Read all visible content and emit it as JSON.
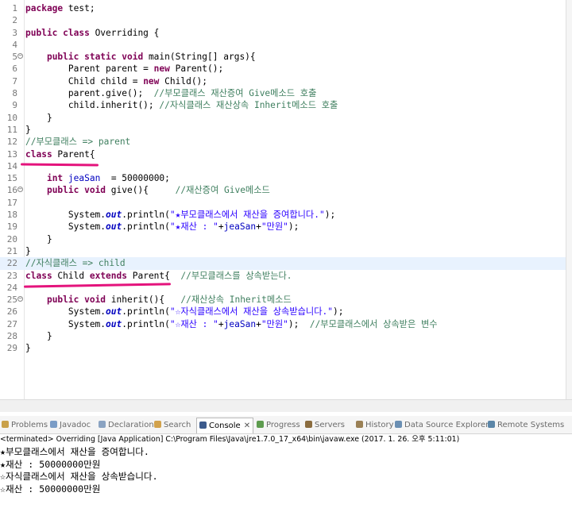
{
  "editor": {
    "lines": [
      {
        "n": "1",
        "fold": "",
        "html": "<span class='k'>package</span> test;"
      },
      {
        "n": "2",
        "fold": "",
        "html": ""
      },
      {
        "n": "3",
        "fold": "",
        "html": "<span class='k'>public class</span> Overriding {"
      },
      {
        "n": "4",
        "fold": "",
        "html": ""
      },
      {
        "n": "5",
        "fold": "−",
        "html": "    <span class='k'>public static void</span> main(String[] args){"
      },
      {
        "n": "6",
        "fold": "",
        "html": "        Parent parent = <span class='k'>new</span> Parent();"
      },
      {
        "n": "7",
        "fold": "",
        "html": "        Child child = <span class='k'>new</span> Child();"
      },
      {
        "n": "8",
        "fold": "",
        "html": "        parent.give();  <span class='c'>//부모클래스 재산증여 Give메소드 호출</span>"
      },
      {
        "n": "9",
        "fold": "",
        "html": "        child.inherit(); <span class='c'>//자식클래스 재산상속 Inherit메소드 호출</span>"
      },
      {
        "n": "10",
        "fold": "",
        "html": "    }"
      },
      {
        "n": "11",
        "fold": "",
        "html": "}"
      },
      {
        "n": "12",
        "fold": "",
        "html": "<span class='c'>//부모클래스 => parent</span>"
      },
      {
        "n": "13",
        "fold": "",
        "html": "<span class='k'>class</span> Parent{"
      },
      {
        "n": "14",
        "fold": "",
        "html": ""
      },
      {
        "n": "15",
        "fold": "",
        "html": "    <span class='k'>int</span> <span class='fn'>jeaSan</span>  = 50000000;"
      },
      {
        "n": "16",
        "fold": "−",
        "html": "    <span class='k'>public void</span> give(){     <span class='c'>//재산증여 Give메소드</span>"
      },
      {
        "n": "17",
        "fold": "",
        "html": ""
      },
      {
        "n": "18",
        "fold": "",
        "html": "        System.<span class='f'>out</span>.println(<span class='s'>\"★부모클래스에서 재산을 증여합니다.\"</span>);"
      },
      {
        "n": "19",
        "fold": "",
        "html": "        System.<span class='f'>out</span>.println(<span class='s'>\"★재산 : \"</span>+<span class='fn'>jeaSan</span>+<span class='s'>\"만원\"</span>);"
      },
      {
        "n": "20",
        "fold": "",
        "html": "    }"
      },
      {
        "n": "21",
        "fold": "",
        "html": "}"
      },
      {
        "n": "22",
        "fold": "",
        "html": "<span class='c'>//자식클래스 => child</span>",
        "current": true
      },
      {
        "n": "23",
        "fold": "",
        "html": "<span class='k'>class</span> Child <span class='k'>extends</span> Parent{  <span class='c'>//부모클래스를 상속받는다.</span>"
      },
      {
        "n": "24",
        "fold": "",
        "html": ""
      },
      {
        "n": "25",
        "fold": "−",
        "html": "    <span class='k'>public void</span> inherit(){   <span class='c'>//재산상속 Inherit메소드</span>"
      },
      {
        "n": "26",
        "fold": "",
        "html": "        System.<span class='f'>out</span>.println(<span class='s'>\"☆자식클래스에서 재산을 상속받습니다.\"</span>);"
      },
      {
        "n": "27",
        "fold": "",
        "html": "        System.<span class='f'>out</span>.println(<span class='s'>\"☆재산 : \"</span>+<span class='fn'>jeaSan</span>+<span class='s'>\"만원\"</span>);  <span class='c'>//부모클래스에서 상속받은 변수</span>"
      },
      {
        "n": "28",
        "fold": "",
        "html": "    }"
      },
      {
        "n": "29",
        "fold": "",
        "html": "}"
      }
    ]
  },
  "tabs": [
    {
      "label": "Problems",
      "icon": "problems-icon",
      "color": "#c9a14a"
    },
    {
      "label": "Javadoc",
      "icon": "javadoc-icon",
      "color": "#7a9cc6"
    },
    {
      "label": "Declaration",
      "icon": "declaration-icon",
      "color": "#8aa3c2"
    },
    {
      "label": "Search",
      "icon": "search-icon",
      "color": "#d2a24c"
    },
    {
      "label": "Console",
      "icon": "console-icon",
      "color": "#3b5a8c",
      "active": true
    },
    {
      "label": "Progress",
      "icon": "progress-icon",
      "color": "#5e9c4f"
    },
    {
      "label": "Servers",
      "icon": "servers-icon",
      "color": "#8b6c3f"
    },
    {
      "label": "History",
      "icon": "history-icon",
      "color": "#9a8055"
    },
    {
      "label": "Data Source Explorer",
      "icon": "data-source-icon",
      "color": "#6b8fb3"
    },
    {
      "label": "Remote Systems",
      "icon": "remote-systems-icon",
      "color": "#5b86a8"
    }
  ],
  "console": {
    "close_glyph": "✕",
    "status": "<terminated> Overriding [Java Application] C:\\Program Files\\Java\\jre1.7.0_17_x64\\bin\\javaw.exe (2017. 1. 26. 오후 5:11:01)",
    "output": [
      "★부모클래스에서 재산을 증여합니다.",
      "★재산 : 50000000만원",
      "☆자식클래스에서 재산을 상속받습니다.",
      "☆재산 : 50000000만원"
    ]
  },
  "colors": {
    "keyword": "#7f0055",
    "string": "#2a00ff",
    "comment": "#3f7f5f",
    "field": "#0000c0",
    "annotation": "#e4137c"
  }
}
